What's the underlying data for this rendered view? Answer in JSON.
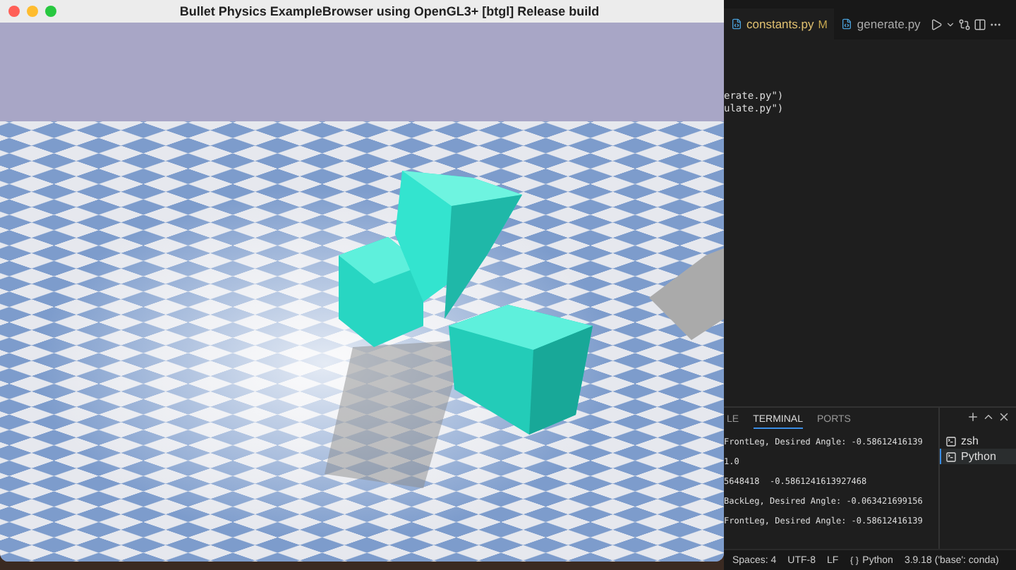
{
  "sim_window": {
    "title": "Bullet Physics ExampleBrowser using OpenGL3+ [btgl] Release build"
  },
  "editor": {
    "tabs": [
      {
        "label": "constants.py",
        "badge": "M",
        "selected": true
      },
      {
        "label": "generate.py",
        "selected": false
      }
    ],
    "code_lines": [
      "erate.py\")",
      "ulate.py\")"
    ]
  },
  "panel": {
    "tabs": [
      {
        "label": "LE",
        "selected": false
      },
      {
        "label": "TERMINAL",
        "selected": true
      },
      {
        "label": "PORTS",
        "selected": false
      }
    ],
    "terminal_lines": [
      "FrontLeg, Desired Angle: -0.58612416139",
      "1.0",
      "5648418  -0.5861241613927468",
      "BackLeg, Desired Angle: -0.063421699156",
      "FrontLeg, Desired Angle: -0.58612416139"
    ],
    "sessions": [
      {
        "label": "zsh",
        "selected": false
      },
      {
        "label": "Python",
        "selected": true
      }
    ]
  },
  "status_bar": [
    "Spaces: 4",
    "UTF-8",
    "LF",
    "Python",
    "3.9.18 ('base': conda)"
  ]
}
